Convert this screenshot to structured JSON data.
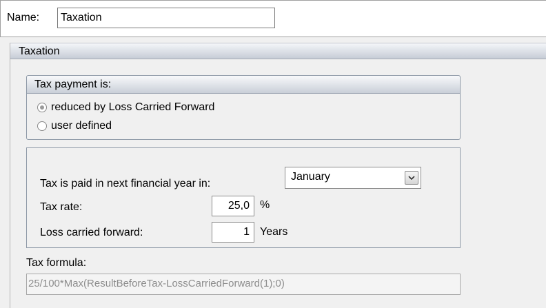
{
  "name_row": {
    "label": "Name:",
    "value": "Taxation"
  },
  "section": {
    "title": "Taxation"
  },
  "tax_payment": {
    "title": "Tax payment is:",
    "options": [
      {
        "label": "reduced by Loss Carried Forward",
        "checked": true
      },
      {
        "label": "user defined",
        "checked": false
      }
    ]
  },
  "settings": {
    "month_label": "Tax is paid in next financial year in:",
    "month_value": "January",
    "rate_label": "Tax rate:",
    "rate_value": "25,0",
    "rate_unit": "%",
    "loss_label": "Loss carried forward:",
    "loss_value": "1",
    "loss_unit": "Years"
  },
  "formula": {
    "label": "Tax formula:",
    "value": "25/100*Max(ResultBeforeTax-LossCarriedForward(1);0)"
  },
  "icons": {
    "dropdown": "chevron-down-icon"
  }
}
